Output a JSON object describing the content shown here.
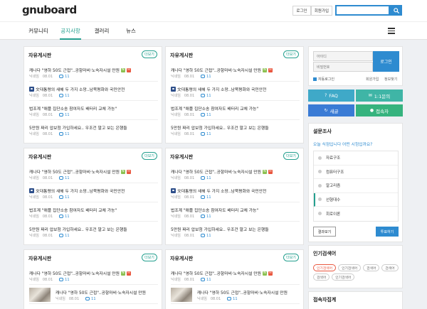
{
  "header": {
    "logo": "gnuboard",
    "login_label": "로그인",
    "join_label": "회원가입",
    "search_placeholder": ""
  },
  "nav": {
    "items": [
      {
        "label": "커뮤니티"
      },
      {
        "label": "공지사항",
        "active": true
      },
      {
        "label": "갤러리"
      },
      {
        "label": "뉴스"
      }
    ]
  },
  "boards": [
    {
      "title": "자유게시판",
      "more": "더보기",
      "posts": [
        {
          "title": "캐나다 \"영하 50도 근접\"..공항마비·노숙자시설 만원",
          "author": "닉네임",
          "date": "08.01",
          "comments": "11",
          "badges": [
            "N",
            "H"
          ]
        },
        {
          "title": "文대통령의 새해 두 가지 소망..남북평화와 국민안전",
          "author": "닉네임",
          "date": "08.01",
          "comments": "11",
          "img": true
        },
        {
          "title": "법조계 \"애플 집단소송 참여자도 배터리 교체 가능\"",
          "author": "닉네임",
          "date": "08.01",
          "comments": "11"
        },
        {
          "title": "5만원 짜리 압보험 가입하세요.. 우조건 말고 보는 은행들",
          "author": "닉네임",
          "date": "08.01",
          "comments": "11"
        }
      ]
    },
    {
      "title": "자유게시판",
      "more": "더보기",
      "posts": [
        {
          "title": "캐나다 \"영하 50도 근접\"..공항마비·노숙자시설 만원",
          "author": "닉네임",
          "date": "08.01",
          "comments": "11",
          "badges": [
            "N",
            "H"
          ]
        },
        {
          "title": "文대통령의 새해 두 가지 소망..남북평화와 국민안전",
          "author": "닉네임",
          "date": "08.01",
          "comments": "11",
          "img": true
        },
        {
          "title": "법조계 \"애플 집단소송 참여자도 배터리 교체 가능\"",
          "author": "닉네임",
          "date": "08.01",
          "comments": "11"
        },
        {
          "title": "5만원 짜리 압보험 가입하세요.. 우조건 말고 보는 은행들",
          "author": "닉네임",
          "date": "08.01",
          "comments": "11"
        }
      ]
    },
    {
      "title": "자유게시판",
      "more": "더보기",
      "posts": [
        {
          "title": "캐나다 \"영하 50도 근접\"..공항마비·노숙자시설 만원",
          "author": "닉네임",
          "date": "08.01",
          "comments": "11",
          "badges": [
            "N",
            "H"
          ]
        },
        {
          "title": "文대통령의 새해 두 가지 소망..남북평화와 국민안전",
          "author": "닉네임",
          "date": "08.01",
          "comments": "11",
          "img": true
        },
        {
          "title": "법조계 \"애플 집단소송 참여자도 배터리 교체 가능\"",
          "author": "닉네임",
          "date": "08.01",
          "comments": "11"
        },
        {
          "title": "5만원 짜리 압보험 가입하세요.. 우조건 말고 보는 은행들",
          "author": "닉네임",
          "date": "08.01",
          "comments": "11"
        }
      ]
    },
    {
      "title": "자유게시판",
      "more": "더보기",
      "posts": [
        {
          "title": "캐나다 \"영하 50도 근접\"..공항마비·노숙자시설 만원",
          "author": "닉네임",
          "date": "08.01",
          "comments": "11",
          "badges": [
            "N",
            "H"
          ]
        },
        {
          "title": "文대통령의 새해 두 가지 소망..남북평화와 국민안전",
          "author": "닉네임",
          "date": "08.01",
          "comments": "11",
          "img": true
        },
        {
          "title": "법조계 \"애플 집단소송 참여자도 배터리 교체 가능\"",
          "author": "닉네임",
          "date": "08.01",
          "comments": "11"
        },
        {
          "title": "5만원 짜리 압보험 가입하세요.. 우조건 말고 보는 은행들",
          "author": "닉네임",
          "date": "08.01",
          "comments": "11"
        }
      ]
    },
    {
      "title": "자유게시판",
      "more": "더보기",
      "top": {
        "title": "캐나다 \"영하 50도 근접\"..공항마비·노숙자시설 만원",
        "author": "닉네임",
        "date": "08.01",
        "comments": "11",
        "badges": [
          "N",
          "H"
        ]
      },
      "gallery": [
        {
          "title": "캐나다 \"영하 50도 근접\"..공항마비·노숙자시설 만원",
          "author": "닉네임",
          "date": "08.01",
          "comments": "11"
        }
      ]
    },
    {
      "title": "자유게시판",
      "more": "더보기",
      "top": {
        "title": "캐나다 \"영하 50도 근접\"..공항마비·노숙자시설 만원",
        "author": "닉네임",
        "date": "08.01",
        "comments": "11",
        "badges": [
          "N",
          "H"
        ]
      },
      "gallery": [
        {
          "title": "캐나다 \"영하 50도 근접\"..공항마비·노숙자시설 만원",
          "author": "닉네임",
          "date": "08.01",
          "comments": "11"
        }
      ]
    }
  ],
  "login": {
    "id_placeholder": "아이디",
    "pw_placeholder": "비밀번호",
    "button": "로그인",
    "auto_login": "자동로그인",
    "join": "회원가입",
    "find": "정보찾기"
  },
  "quick": {
    "faq": "FAQ",
    "qna": "1:1문의",
    "new": "새글",
    "connect": "접속자"
  },
  "poll": {
    "title": "설문조사",
    "question": "오늘 식점입니다 어떤 시험입까요?",
    "options": [
      {
        "label": "자료구조"
      },
      {
        "label": "컴퓨터구조"
      },
      {
        "label": "알고리즘"
      },
      {
        "label": "선형대수",
        "selected": true
      },
      {
        "label": "회로이론"
      }
    ],
    "result_label": "결과보기",
    "vote_label": "투표하기"
  },
  "popular": {
    "title": "인기검색어",
    "tags": [
      {
        "label": "인기검색어",
        "hot": true
      },
      {
        "label": "인기검색어"
      },
      {
        "label": "검색어"
      },
      {
        "label": "검색어"
      },
      {
        "label": "검색어"
      },
      {
        "label": "인기검색어"
      }
    ]
  },
  "visitors": {
    "title": "접속자집계"
  },
  "colors": {
    "accent_teal": "#25a08f",
    "accent_blue": "#2e8bd0",
    "faq_bg": "#3fa9c8",
    "qna_bg": "#3fb5a6",
    "new_bg": "#3a7bd5",
    "connect_bg": "#36b37e"
  }
}
